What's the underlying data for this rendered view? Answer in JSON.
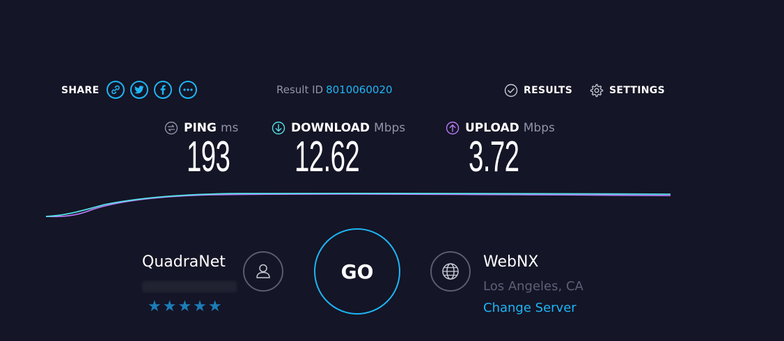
{
  "share": {
    "label": "SHARE",
    "icons": [
      "link-icon",
      "twitter-icon",
      "facebook-icon",
      "more-icon"
    ]
  },
  "result": {
    "label": "Result ID",
    "id": "8010060020"
  },
  "nav": {
    "results_label": "RESULTS",
    "settings_label": "SETTINGS"
  },
  "metrics": {
    "ping": {
      "name": "PING",
      "unit": "ms",
      "value": "193"
    },
    "download": {
      "name": "DOWNLOAD",
      "unit": "Mbps",
      "value": "12.62"
    },
    "upload": {
      "name": "UPLOAD",
      "unit": "Mbps",
      "value": "3.72"
    }
  },
  "colors": {
    "background": "#141526",
    "accent": "#1eb5f5",
    "download_line": "#54e0e6",
    "upload_line": "#b77bf5",
    "muted": "#9193a8"
  },
  "isp": {
    "name": "QuadraNet",
    "rating": "★★★★★"
  },
  "go_button": {
    "label": "GO"
  },
  "server": {
    "name": "WebNX",
    "location": "Los Angeles, CA",
    "change_label": "Change Server"
  }
}
